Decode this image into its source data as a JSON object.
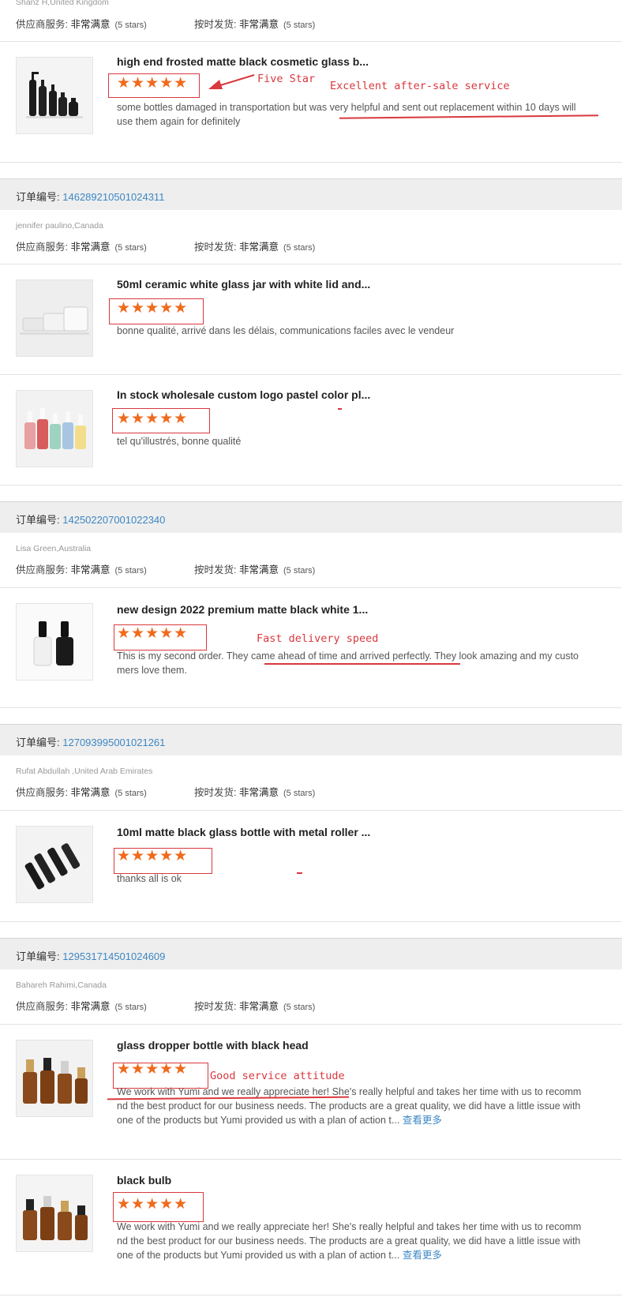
{
  "labels": {
    "order_no": "订单编号:",
    "supplier_service": "供应商服务:",
    "on_time_delivery": "按时发货:",
    "rating_value": "非常满意",
    "stars_text": "(5 stars)",
    "see_more": "查看更多"
  },
  "stars": "★★★★★",
  "top": {
    "buyer": "Shanz H,United Kingdom"
  },
  "orders": [
    {
      "number": "146289210501024311",
      "buyer": "jennifer paulino,Canada"
    },
    {
      "number": "142502207001022340",
      "buyer": "Lisa Green,Australia"
    },
    {
      "number": "127093995001021261",
      "buyer": "Rufat Abdullah ,United Arab Emirates"
    },
    {
      "number": "129531714501024609",
      "buyer": "Bahareh Rahimi,Canada"
    }
  ],
  "products": [
    {
      "title": "high end frosted matte black cosmetic glass b...",
      "comment": [
        "some bottles damaged in transportation but was very helpful and sent out replacement within 10 days will",
        "use them again for definitely"
      ]
    },
    {
      "title": "50ml ceramic white glass jar with white lid and...",
      "comment": [
        "bonne qualité, arrivé dans les délais, communications faciles avec le vendeur"
      ]
    },
    {
      "title": "In stock wholesale custom logo pastel color pl...",
      "comment": [
        "tel qu'illustrés, bonne qualité"
      ]
    },
    {
      "title": "new design 2022 premium matte black white 1...",
      "comment": [
        "This is my second order. They came ahead of time and arrived perfectly. They look amazing and my custo",
        "mers love them."
      ]
    },
    {
      "title": "10ml matte black glass bottle with metal roller ...",
      "comment": [
        "thanks all is ok"
      ]
    },
    {
      "title": "glass dropper bottle with black head",
      "comment": [
        "We work with Yumi and we really appreciate her! She's really helpful and takes her time with us to recomm",
        "nd the best product for our business needs. The products are a great quality, we did have a little issue with",
        "one of the products but Yumi provided us with a plan of action t..."
      ]
    },
    {
      "title": "black bulb",
      "comment": [
        "We work with Yumi and we really appreciate her! She's really helpful and takes her time with us to recomm",
        "nd the best product for our business needs. The products are a great quality, we did have a little issue with",
        "one of the products but Yumi provided us with a plan of action t..."
      ]
    }
  ],
  "annotations": {
    "five_star": "Five Star",
    "after_sale": "Excellent after-sale service",
    "fast_delivery": "Fast delivery speed",
    "good_service": "Good service attitude"
  },
  "colors": {
    "star": "#ef6a1c",
    "annotation": "#d9383e",
    "link": "#3c87c4",
    "header_bg": "#eeeeee"
  }
}
